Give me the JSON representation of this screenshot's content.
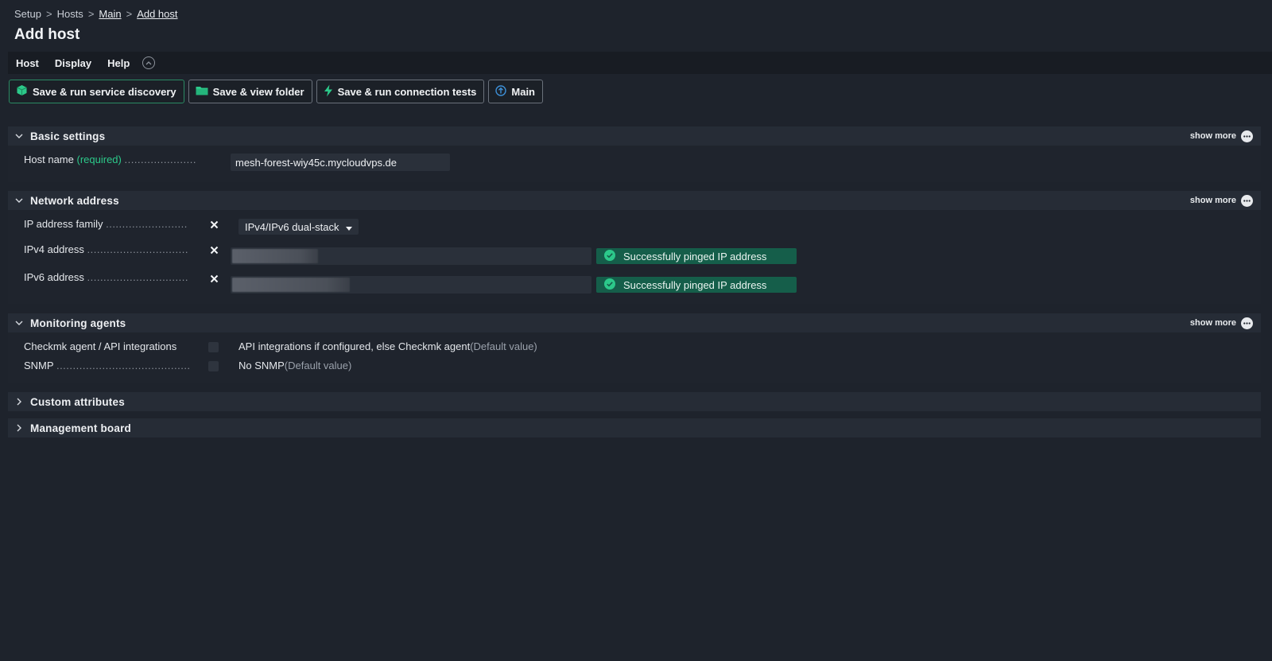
{
  "breadcrumb": {
    "items": [
      {
        "label": "Setup",
        "link": false
      },
      {
        "label": "Hosts",
        "link": false
      },
      {
        "label": "Main",
        "link": true
      },
      {
        "label": "Add host",
        "link": true
      }
    ],
    "separator": ">"
  },
  "page_title": "Add host",
  "menu": {
    "items": [
      "Host",
      "Display",
      "Help"
    ]
  },
  "toolbar": {
    "buttons": [
      {
        "label": "Save & run service discovery",
        "icon": "box-icon"
      },
      {
        "label": "Save & view folder",
        "icon": "folder-icon"
      },
      {
        "label": "Save & run connection tests",
        "icon": "lightning-icon"
      },
      {
        "label": "Main",
        "icon": "arrow-up-circle-icon"
      }
    ]
  },
  "sections": {
    "basic": {
      "title": "Basic settings",
      "show_more": "show more",
      "host_name_label": "Host name",
      "host_name_required": "(required)",
      "host_name_value": "mesh-forest-wiy45c.mycloudvps.de"
    },
    "network": {
      "title": "Network address",
      "show_more": "show more",
      "ip_family_label": "IP address family",
      "ip_family_value": "IPv4/IPv6 dual-stack",
      "ipv4_label": "IPv4 address",
      "ipv6_label": "IPv6 address",
      "ipv4_status": "Successfully pinged IP address",
      "ipv6_status": "Successfully pinged IP address"
    },
    "monitoring": {
      "title": "Monitoring agents",
      "show_more": "show more",
      "agent_label": "Checkmk agent / API integrations",
      "agent_value": "API integrations if configured, else Checkmk agent",
      "agent_default": "(Default value)",
      "snmp_label": "SNMP",
      "snmp_value": "No SNMP",
      "snmp_default": "(Default value)"
    },
    "custom": {
      "title": "Custom attributes"
    },
    "management": {
      "title": "Management board"
    }
  },
  "colors": {
    "background": "#1e232c",
    "accent_green": "#2cc98a",
    "status_badge": "#155e4a"
  }
}
